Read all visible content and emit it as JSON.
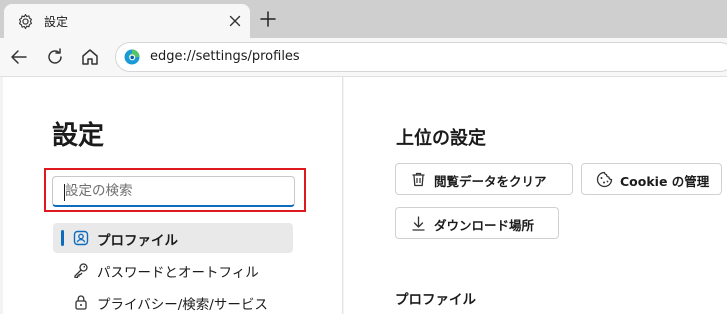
{
  "tab": {
    "title": "設定",
    "icon": "gear-icon"
  },
  "toolbar": {
    "url": "edge://settings/profiles"
  },
  "sidebar": {
    "title": "設定",
    "search_placeholder": "設定の検索",
    "items": [
      {
        "label": "プロファイル",
        "icon": "profile-icon",
        "active": true
      },
      {
        "label": "パスワードとオートフィル",
        "icon": "key-icon",
        "active": false
      },
      {
        "label": "プライバシー/検索/サービス",
        "icon": "lock-icon",
        "active": false
      }
    ]
  },
  "main": {
    "section_title": "上位の設定",
    "buttons": [
      {
        "label": "閲覧データをクリア",
        "icon": "trash-icon"
      },
      {
        "label": "Cookie の管理",
        "icon": "cookie-icon"
      },
      {
        "label": "ダウンロード場所",
        "icon": "download-icon"
      }
    ],
    "profile_heading": "プロファイル"
  },
  "colors": {
    "accent": "#0f6cbd",
    "highlight_border": "#e0191e"
  }
}
